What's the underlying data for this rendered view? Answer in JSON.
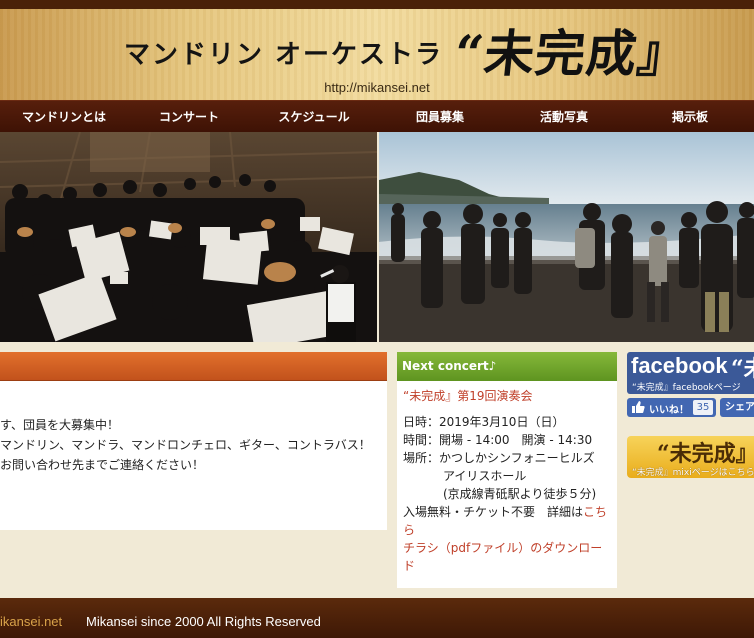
{
  "header": {
    "title": "マンドリン オーケストラ",
    "logo_text": "“未完成』",
    "url": "http://mikansei.net"
  },
  "nav": {
    "items": [
      {
        "label": "マンドリンとは"
      },
      {
        "label": "コンサート"
      },
      {
        "label": "スケジュール"
      },
      {
        "label": "団員募集"
      },
      {
        "label": "活動写真"
      },
      {
        "label": "掲示板"
      }
    ]
  },
  "news": {
    "lines": [
      "す、団員を大募集中！",
      "マンドリン、マンドラ、マンドロンチェロ、ギター、コントラバス！",
      "お問い合わせ先までご連絡ください！"
    ]
  },
  "concert": {
    "heading": "Next concert♪",
    "title": "“未完成』第19回演奏会",
    "date": "日時：2019年3月10日（日）",
    "time": "時間：開場 - 14:00　開演 - 14:30",
    "venue": "場所：かつしかシンフォニーヒルズ",
    "venue_hall": "アイリスホール",
    "venue_access": "(京成線青砥駅より徒歩５分)",
    "admission": "入場無料・チケット不要　詳細は",
    "details_link": "こちら",
    "flyer_link": "チラシ（pdfファイル）のダウンロード"
  },
  "sidebar": {
    "facebook_word": "facebook",
    "facebook_logo": "“未",
    "facebook_caption": "“未完成』facebookページ",
    "like_label": "いいね！",
    "like_count": "35",
    "share_label": "シェア",
    "mixi_logo": "“未完成』",
    "mixi_caption": "“未完成』mixiページはこちら"
  },
  "footer": {
    "domain": "ikansei.net",
    "copyright": "Mikansei since 2000 All Rights Reserved"
  },
  "colors": {
    "nav_bg": "#4a1808",
    "news_header": "#d4602a",
    "concert_header": "#74a830",
    "link_red": "#c0402a",
    "facebook_blue": "#3b5998",
    "mixi_gold": "#f0bd2f",
    "footer_bg": "#4a1f08"
  }
}
